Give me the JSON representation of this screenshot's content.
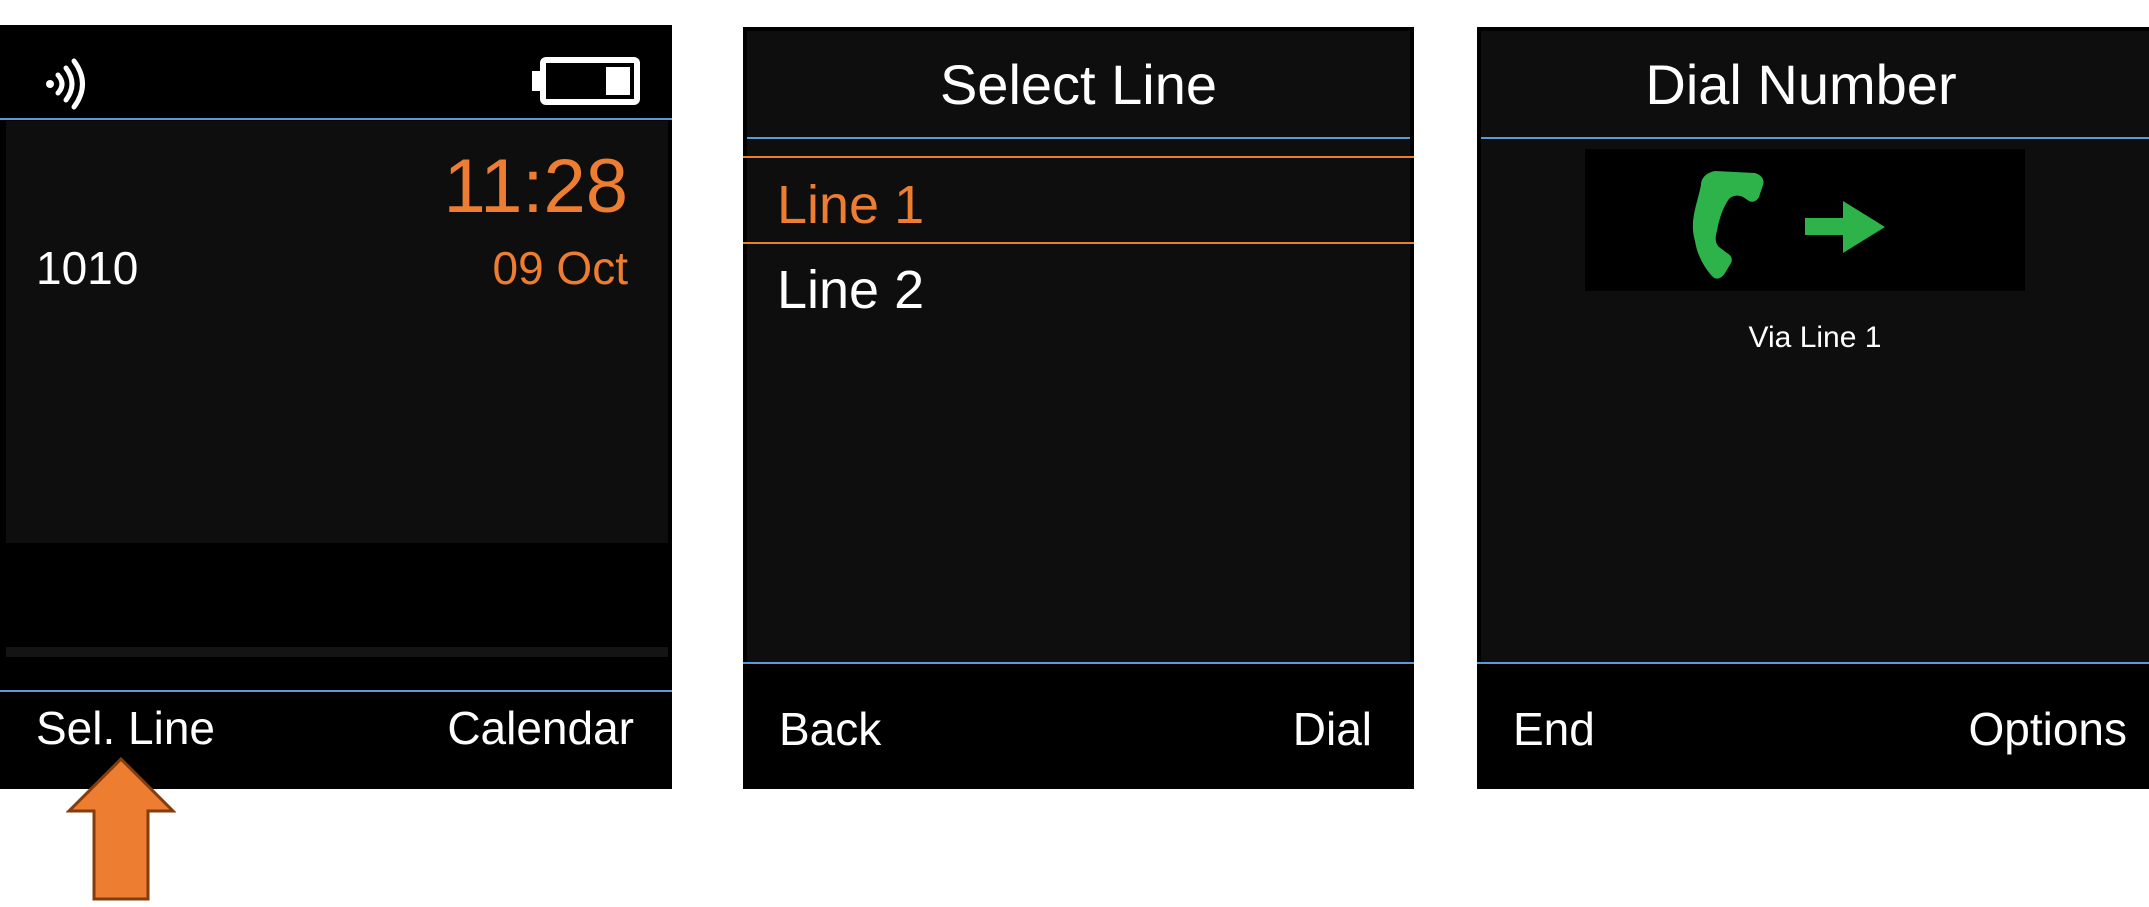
{
  "colors": {
    "screen_bg": "#000000",
    "panel_bg": "#0e0e0e",
    "divider_blue": "#5b9bd5",
    "accent_orange": "#ed7d31",
    "call_green": "#2db34a",
    "text": "#ffffff"
  },
  "screen1": {
    "status": {
      "signal_icon": "signal-icon",
      "battery_icon": "battery-icon"
    },
    "time": "11:28",
    "extension": "1010",
    "date": "09 Oct",
    "softkeys": {
      "left": "Sel. Line",
      "right": "Calendar"
    },
    "pointer_icon": "up-arrow-icon"
  },
  "screen2": {
    "title": "Select Line",
    "items": [
      {
        "label": "Line 1",
        "selected": true
      },
      {
        "label": "Line 2",
        "selected": false
      }
    ],
    "softkeys": {
      "left": "Back",
      "right": "Dial"
    }
  },
  "screen3": {
    "title": "Dial Number",
    "call_icon": "outgoing-call-icon",
    "via": "Via Line 1",
    "softkeys": {
      "left": "End",
      "right": "Options"
    }
  }
}
